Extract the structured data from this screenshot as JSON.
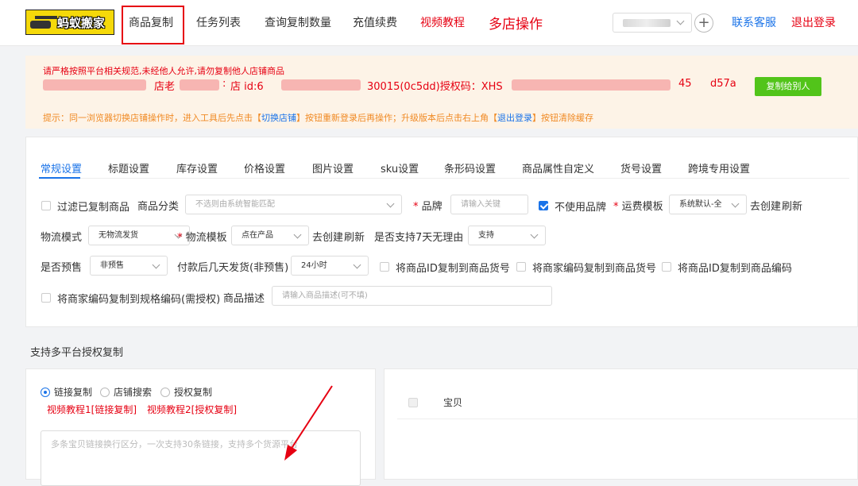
{
  "logo": {
    "text": "蚂蚁搬家"
  },
  "nav": {
    "items": [
      {
        "label": "商品复制",
        "color": "#333333"
      },
      {
        "label": "任务列表",
        "color": "#333333"
      },
      {
        "label": "查询复制数量",
        "color": "#333333"
      },
      {
        "label": "充值续费",
        "color": "#333333"
      },
      {
        "label": "视频教程",
        "color": "#e60012"
      },
      {
        "label": "多店操作",
        "color": "#e60012"
      }
    ],
    "active_index": 0,
    "store_select_value": "",
    "contact": "联系客服",
    "logout": "退出登录"
  },
  "notice": {
    "warning": "请严格按照平台相关规范,未经他人允许,请勿复制他人店铺商品",
    "blurred_fragments": [
      "店老",
      ":",
      "店 id:6",
      "30015(0c5dd)授权码：XHS",
      "45",
      "d57a"
    ],
    "copy_button": "复制给别人",
    "tip": {
      "part1": "提示：同一浏览器切换店铺操作时，进入工具后先点击【",
      "link1": "切换店铺",
      "part2": "】按钮重新登录后再操作；升级版本后点击右上角【",
      "link2": "退出登录",
      "part3": "】按钮清除缓存"
    }
  },
  "tabs": [
    "常规设置",
    "标题设置",
    "库存设置",
    "价格设置",
    "图片设置",
    "sku设置",
    "条形码设置",
    "商品属性自定义",
    "货号设置",
    "跨境专用设置"
  ],
  "settings": {
    "filter_copied": {
      "label": "过滤已复制商品",
      "checked": false
    },
    "category": {
      "label": "商品分类",
      "placeholder": "不选则由系统智能匹配"
    },
    "brand": {
      "label": "品牌",
      "placeholder": "请输入关键"
    },
    "no_brand": {
      "label": "不使用品牌",
      "checked": true
    },
    "freight_template": {
      "label": "运费模板",
      "value": "系统默认-全"
    },
    "create_link": "去创建",
    "refresh_link": "刷新",
    "logistics_mode": {
      "label": "物流模式",
      "value": "无物流发货"
    },
    "logistics_template": {
      "label": "物流模板",
      "value": "点在产品"
    },
    "seven_day": {
      "label": "是否支持7天无理由",
      "value": "支持"
    },
    "presale": {
      "label": "是否预售",
      "value": "非预售"
    },
    "ship_days": {
      "label": "付款后几天发货(非预售)",
      "value": "24小时"
    },
    "opt1": {
      "label": "将商品ID复制到商品货号",
      "checked": false
    },
    "opt2": {
      "label": "将商家编码复制到商品货号",
      "checked": false
    },
    "opt3": {
      "label": "将商品ID复制到商品编码",
      "checked": false
    },
    "opt4": {
      "label": "将商家编码复制到规格编码(需授权)",
      "checked": false
    },
    "description": {
      "label": "商品描述",
      "placeholder": "请输入商品描述(可不填)"
    }
  },
  "section": {
    "title": "支持多平台授权复制"
  },
  "copy_modes": [
    {
      "label": "链接复制",
      "selected": true
    },
    {
      "label": "店铺搜索",
      "selected": false
    },
    {
      "label": "授权复制",
      "selected": false
    }
  ],
  "video_links": [
    "视频教程1[链接复制]",
    "视频教程2[授权复制]"
  ],
  "link_textarea": {
    "placeholder": "多条宝贝链接换行区分，一次支持30条链接，支持多个货源平台"
  },
  "table": {
    "header_item": "宝贝"
  }
}
